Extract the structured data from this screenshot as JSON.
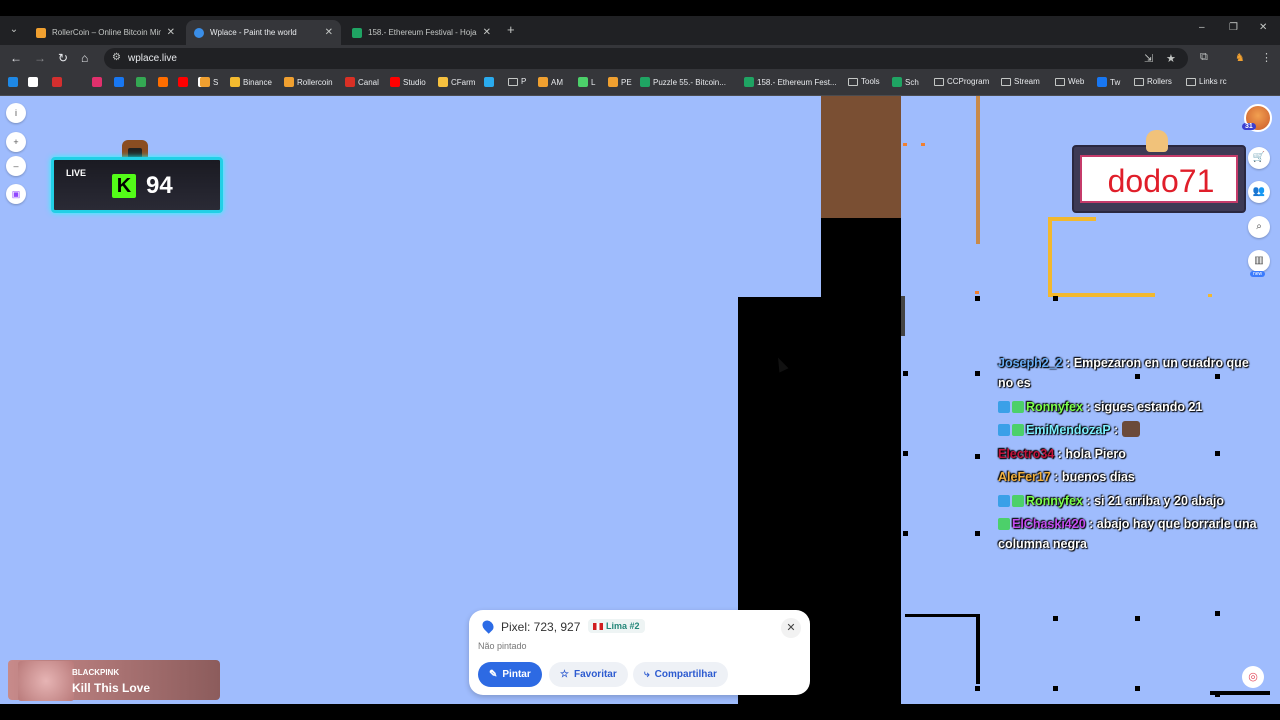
{
  "browser": {
    "tabs": [
      {
        "title": "RollerCoin – Online Bitcoin Mining",
        "close": "✕"
      },
      {
        "title": "Wplace - Paint the world",
        "close": "✕"
      },
      {
        "title": "158.- Ethereum Festival - Hojas",
        "close": "✕"
      }
    ],
    "new_tab": "+",
    "window_controls": {
      "minimize": "–",
      "restore": "❐",
      "close": "✕"
    },
    "url": "wplace.live",
    "bookmarks": [
      {
        "label": ""
      },
      {
        "label": ""
      },
      {
        "label": ""
      },
      {
        "label": ""
      },
      {
        "label": ""
      },
      {
        "label": ""
      },
      {
        "label": ""
      },
      {
        "label": ""
      },
      {
        "label": ""
      },
      {
        "label": "S"
      },
      {
        "label": "Binance"
      },
      {
        "label": "Rollercoin"
      },
      {
        "label": "Canal"
      },
      {
        "label": "Studio"
      },
      {
        "label": "CFarm"
      },
      {
        "label": ""
      },
      {
        "label": "P"
      },
      {
        "label": "AM"
      },
      {
        "label": "L"
      },
      {
        "label": "PE"
      },
      {
        "label": "Puzzle 55.- Bitcoin..."
      },
      {
        "label": "158.- Ethereum Fest..."
      },
      {
        "label": "Tools"
      },
      {
        "label": "Sch"
      },
      {
        "label": "CCProgram"
      },
      {
        "label": "Stream"
      },
      {
        "label": "Web"
      },
      {
        "label": "Tw"
      },
      {
        "label": "Rollers"
      },
      {
        "label": "Links rc"
      }
    ]
  },
  "live_widget": {
    "label": "LIVE",
    "kick_letter": "K",
    "viewer_count": "94"
  },
  "nameplate": {
    "nick": "dodo71"
  },
  "avatar_badge": "31",
  "new_badge": "new",
  "chat": [
    {
      "user": "Joseph2_2",
      "user_color": "#6aaef7",
      "message": ": Empezaron en un cuadro que no es",
      "badges": []
    },
    {
      "user": "Ronnyfex",
      "user_color": "#7cff4d",
      "message": ": sigues estando 21",
      "badges": [
        "#3aa0e8",
        "#4cd06a"
      ]
    },
    {
      "user": "EmiMendozaP",
      "user_color": "#7cf0ff",
      "message": ":",
      "badges": [
        "#3aa0e8",
        "#4cd06a"
      ],
      "emote": true
    },
    {
      "user": "Electro34",
      "user_color": "#c0143c",
      "message": ": hola Piero",
      "badges": []
    },
    {
      "user": "AleFer17",
      "user_color": "#f0b040",
      "message": ": buenos dias",
      "badges": []
    },
    {
      "user": "Ronnyfex",
      "user_color": "#7cff4d",
      "message": ": si 21 arriba y 20 abajo",
      "badges": [
        "#3aa0e8",
        "#4cd06a"
      ]
    },
    {
      "user": "ElChaski420",
      "user_color": "#c34df0",
      "message": ": abajo hay que borrarle una columna negra",
      "badges": [
        "#4cd06a"
      ]
    }
  ],
  "pixel_panel": {
    "pixel_label": "Pixel: 723, 927",
    "region": "Lima #2",
    "status": "Não pintado",
    "paint_label": "Pintar",
    "favorite_label": "Favoritar",
    "share_label": "Compartilhar",
    "close": "✕"
  },
  "now_playing": {
    "artist": "BLACKPINK",
    "song": "Kill This Love"
  },
  "colors": {
    "map_bg": "#9fbcfd",
    "accent": "#2d6ae3",
    "kick_green": "#53fc18"
  }
}
